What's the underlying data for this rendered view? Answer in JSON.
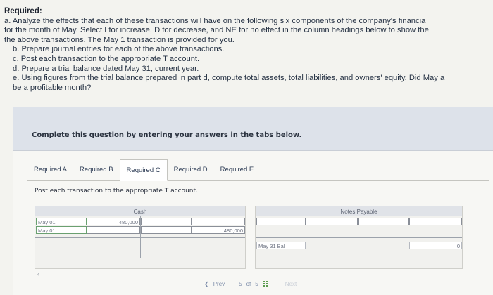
{
  "instructions": {
    "title": "Required:",
    "a_line1": "a. Analyze the effects that each of these transactions will have on the following six components of the company's financia",
    "a_line2": "for the month of May. Select I for increase, D for decrease, and NE for no effect in the column headings below to show the",
    "a_line3": "the above transactions. The May 1 transaction is provided for you.",
    "b": "b. Prepare journal entries for each of the above transactions.",
    "c": "c. Post each transaction to the appropriate T account.",
    "d": "d. Prepare a trial balance dated May 31, current year.",
    "e_line1": "e. Using figures from the trial balance prepared in part d, compute total assets, total liabilities, and owners' equity. Did May a",
    "e_line2": "be a profitable month?"
  },
  "panel": {
    "header": "Complete this question by entering your answers in the tabs below.",
    "tabs": [
      {
        "label": "Required A"
      },
      {
        "label": "Required B"
      },
      {
        "label": "Required C"
      },
      {
        "label": "Required D"
      },
      {
        "label": "Required E"
      }
    ],
    "active_tab": "Required C",
    "instruction": "Post each transaction to the appropriate T account."
  },
  "cash_account": {
    "title": "Cash",
    "row1": {
      "date": "May 01",
      "debit": "480,000",
      "date2": "",
      "credit": ""
    },
    "row2": {
      "date": "May 01",
      "debit": "",
      "date2": "",
      "credit": "480,000"
    }
  },
  "notes_payable_account": {
    "title": "Notes Payable",
    "balance_label": "May 31 Bal",
    "balance_value": "0"
  },
  "pager": {
    "prev": "Prev",
    "current": "5",
    "of": "of",
    "total": "5",
    "next": "Next"
  },
  "colors": {
    "header_bg": "#dde2ea",
    "field_border": "#8a8f98",
    "grid_icon": "#5b9b4e"
  }
}
